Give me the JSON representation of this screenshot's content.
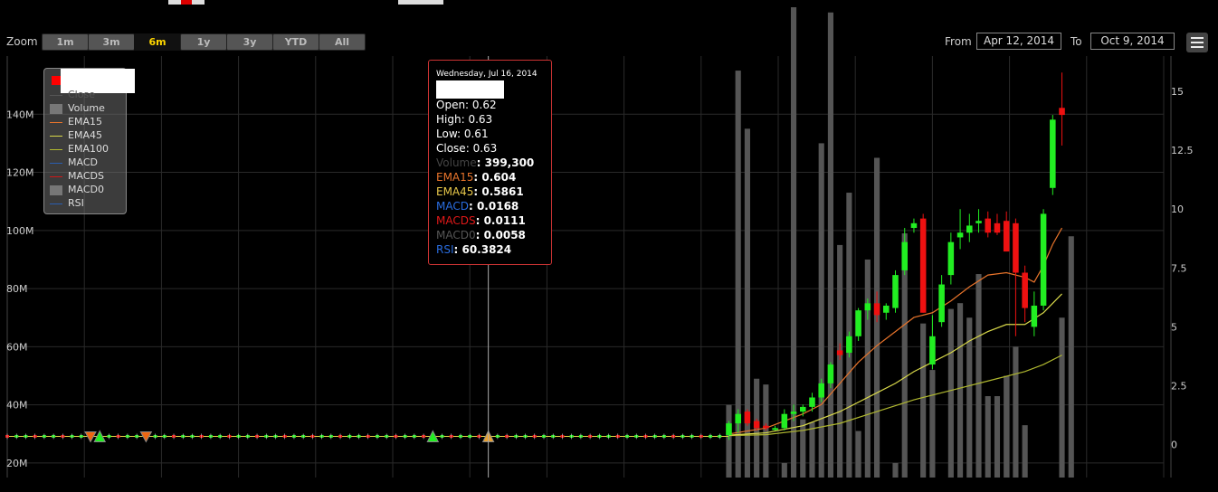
{
  "toolbar": {
    "zoom_label": "Zoom",
    "ranges": [
      "1m",
      "3m",
      "6m",
      "1y",
      "3y",
      "YTD",
      "All"
    ],
    "active_range": "6m",
    "from_label": "From",
    "from_date": "Apr 12, 2014",
    "to_label": "To",
    "to_date": "Oct 9, 2014",
    "menu_icon": "hamburger-icon"
  },
  "legend": {
    "items": [
      {
        "label": "Close",
        "color": "#555555",
        "type": "line"
      },
      {
        "label": "Volume",
        "color": "#777777",
        "type": "box"
      },
      {
        "label": "EMA15",
        "color": "#e8742b",
        "type": "line"
      },
      {
        "label": "EMA45",
        "color": "#d9d94a",
        "type": "line"
      },
      {
        "label": "EMA100",
        "color": "#b0b830",
        "type": "line"
      },
      {
        "label": "MACD",
        "color": "#2a5db0",
        "type": "line"
      },
      {
        "label": "MACDS",
        "color": "#d01818",
        "type": "line"
      },
      {
        "label": "MACD0",
        "color": "#777777",
        "type": "box"
      },
      {
        "label": "RSI",
        "color": "#2a5db0",
        "type": "line"
      }
    ]
  },
  "tooltip": {
    "date": "Wednesday, Jul 16, 2014",
    "open_label": "Open:",
    "open": "0.62",
    "high_label": "High:",
    "high": "0.63",
    "low_label": "Low:",
    "low": "0.61",
    "close_label": "Close:",
    "close": "0.63",
    "volume_label": "Volume",
    "volume": ": 399,300",
    "ema15_label": "EMA15",
    "ema15": ": 0.604",
    "ema45_label": "EMA45",
    "ema45": ": 0.5861",
    "macd_label": "MACD",
    "macd": ": 0.0168",
    "macds_label": "MACDS",
    "macds": ": 0.0111",
    "macd0_label": "MACD0",
    "macd0": ": 0.0058",
    "rsi_label": "RSI",
    "rsi": ": 60.3824"
  },
  "colors": {
    "up": "#22ee22",
    "down": "#ee1111",
    "volume": "#555555",
    "ema15": "#e8742b",
    "ema45": "#d9d94a",
    "ema100": "#b0b830",
    "grid": "#2a2a2a",
    "background": "#000000"
  },
  "chart_data": {
    "type": "candlestick",
    "left_axis": {
      "ticks": [
        "20M",
        "40M",
        "60M",
        "80M",
        "100M",
        "120M",
        "140M"
      ],
      "values": [
        20,
        40,
        60,
        80,
        100,
        120,
        140
      ]
    },
    "right_axis": {
      "ticks": [
        "0",
        "2.5",
        "5",
        "7.5",
        "10",
        "12.5",
        "15"
      ],
      "values": [
        0,
        2.5,
        5,
        7.5,
        10,
        12.5,
        15
      ]
    },
    "ylim_right": [
      -1.4,
      16.5
    ],
    "ylim_left": [
      15,
      160
    ],
    "x_range": [
      0,
      125
    ],
    "crosshair_x": 52,
    "grid": true,
    "flat_period": {
      "x_start": 0,
      "x_end": 78,
      "price": 0.35
    },
    "markers": [
      {
        "x": 9,
        "type": "down",
        "color": "#ee6611"
      },
      {
        "x": 10,
        "type": "up",
        "color": "#22ee22"
      },
      {
        "x": 15,
        "type": "down",
        "color": "#ee6611"
      },
      {
        "x": 46,
        "type": "up",
        "color": "#22ee22"
      },
      {
        "x": 52,
        "type": "up",
        "color": "#e8a030"
      }
    ],
    "candles": [
      {
        "x": 78,
        "o": 0.4,
        "h": 1.0,
        "l": 0.2,
        "c": 0.9
      },
      {
        "x": 79,
        "o": 0.9,
        "h": 1.5,
        "l": 0.5,
        "c": 1.3
      },
      {
        "x": 80,
        "o": 1.4,
        "h": 1.5,
        "l": 0.8,
        "c": 0.9
      },
      {
        "x": 81,
        "o": 1.0,
        "h": 1.1,
        "l": 0.6,
        "c": 0.7
      },
      {
        "x": 82,
        "o": 0.8,
        "h": 0.9,
        "l": 0.6,
        "c": 0.7
      },
      {
        "x": 83,
        "o": 0.7,
        "h": 0.8,
        "l": 0.6,
        "c": 0.7
      },
      {
        "x": 84,
        "o": 0.7,
        "h": 1.5,
        "l": 0.6,
        "c": 1.3
      },
      {
        "x": 85,
        "o": 1.3,
        "h": 1.7,
        "l": 1.0,
        "c": 1.4
      },
      {
        "x": 86,
        "o": 1.4,
        "h": 1.7,
        "l": 1.2,
        "c": 1.6
      },
      {
        "x": 87,
        "o": 1.6,
        "h": 2.2,
        "l": 1.4,
        "c": 2.0
      },
      {
        "x": 88,
        "o": 2.0,
        "h": 2.8,
        "l": 1.8,
        "c": 2.6
      },
      {
        "x": 89,
        "o": 2.6,
        "h": 3.5,
        "l": 2.4,
        "c": 3.4
      },
      {
        "x": 90,
        "o": 4.0,
        "h": 4.3,
        "l": 3.6,
        "c": 3.8
      },
      {
        "x": 91,
        "o": 3.9,
        "h": 4.8,
        "l": 3.7,
        "c": 4.6
      },
      {
        "x": 92,
        "o": 4.6,
        "h": 5.8,
        "l": 4.4,
        "c": 5.7
      },
      {
        "x": 93,
        "o": 5.7,
        "h": 6.2,
        "l": 5.3,
        "c": 6.0
      },
      {
        "x": 94,
        "o": 6.0,
        "h": 6.5,
        "l": 5.2,
        "c": 5.5
      },
      {
        "x": 95,
        "o": 5.6,
        "h": 6.0,
        "l": 5.3,
        "c": 5.9
      },
      {
        "x": 96,
        "o": 5.8,
        "h": 7.4,
        "l": 5.6,
        "c": 7.2
      },
      {
        "x": 97,
        "o": 7.4,
        "h": 9.2,
        "l": 7.2,
        "c": 8.6
      },
      {
        "x": 98,
        "o": 9.2,
        "h": 9.6,
        "l": 9.0,
        "c": 9.4
      },
      {
        "x": 99,
        "o": 9.6,
        "h": 9.8,
        "l": 5.6,
        "c": 5.6
      },
      {
        "x": 100,
        "o": 3.4,
        "h": 5.5,
        "l": 3.2,
        "c": 4.6
      },
      {
        "x": 101,
        "o": 5.2,
        "h": 7.2,
        "l": 5.0,
        "c": 6.8
      },
      {
        "x": 102,
        "o": 7.2,
        "h": 9.0,
        "l": 6.8,
        "c": 8.6
      },
      {
        "x": 103,
        "o": 8.8,
        "h": 10.0,
        "l": 8.3,
        "c": 9.0
      },
      {
        "x": 104,
        "o": 9.0,
        "h": 9.8,
        "l": 8.6,
        "c": 9.3
      },
      {
        "x": 105,
        "o": 9.4,
        "h": 10.0,
        "l": 9.0,
        "c": 9.5
      },
      {
        "x": 106,
        "o": 9.6,
        "h": 9.9,
        "l": 8.8,
        "c": 9.0
      },
      {
        "x": 107,
        "o": 9.4,
        "h": 9.8,
        "l": 8.9,
        "c": 9.0
      },
      {
        "x": 108,
        "o": 9.5,
        "h": 9.9,
        "l": 8.2,
        "c": 8.2
      },
      {
        "x": 109,
        "o": 9.4,
        "h": 9.6,
        "l": 4.6,
        "c": 7.3
      },
      {
        "x": 110,
        "o": 7.3,
        "h": 7.6,
        "l": 5.2,
        "c": 5.8
      },
      {
        "x": 111,
        "o": 5.0,
        "h": 6.5,
        "l": 4.6,
        "c": 5.9
      },
      {
        "x": 112,
        "o": 5.9,
        "h": 10.0,
        "l": 5.7,
        "c": 9.8
      },
      {
        "x": 113,
        "o": 10.9,
        "h": 14.0,
        "l": 10.6,
        "c": 13.8
      },
      {
        "x": 114,
        "o": 14.3,
        "h": 15.8,
        "l": 12.7,
        "c": 14.0
      }
    ],
    "volume": [
      {
        "x": 78,
        "v": 40
      },
      {
        "x": 79,
        "v": 155
      },
      {
        "x": 80,
        "v": 135
      },
      {
        "x": 81,
        "v": 49
      },
      {
        "x": 82,
        "v": 47
      },
      {
        "x": 84,
        "v": 20
      },
      {
        "x": 85,
        "v": 178
      },
      {
        "x": 86,
        "v": 35
      },
      {
        "x": 87,
        "v": 34
      },
      {
        "x": 88,
        "v": 130
      },
      {
        "x": 89,
        "v": 175
      },
      {
        "x": 90,
        "v": 95
      },
      {
        "x": 91,
        "v": 113
      },
      {
        "x": 92,
        "v": 31
      },
      {
        "x": 93,
        "v": 90
      },
      {
        "x": 94,
        "v": 125
      },
      {
        "x": 95,
        "v": 12
      },
      {
        "x": 96,
        "v": 20
      },
      {
        "x": 97,
        "v": 99
      },
      {
        "x": 98,
        "v": 8
      },
      {
        "x": 99,
        "v": 68
      },
      {
        "x": 100,
        "v": 52
      },
      {
        "x": 101,
        "v": 15
      },
      {
        "x": 102,
        "v": 73
      },
      {
        "x": 103,
        "v": 75
      },
      {
        "x": 104,
        "v": 70
      },
      {
        "x": 105,
        "v": 85
      },
      {
        "x": 106,
        "v": 43
      },
      {
        "x": 107,
        "v": 43
      },
      {
        "x": 108,
        "v": 50
      },
      {
        "x": 109,
        "v": 60
      },
      {
        "x": 110,
        "v": 33
      },
      {
        "x": 111,
        "v": 10
      },
      {
        "x": 112,
        "v": 15
      },
      {
        "x": 113,
        "v": 10
      },
      {
        "x": 114,
        "v": 70
      },
      {
        "x": 115,
        "v": 98
      }
    ],
    "ema15": [
      [
        78,
        0.45
      ],
      [
        82,
        0.7
      ],
      [
        86,
        1.3
      ],
      [
        88,
        1.7
      ],
      [
        90,
        2.6
      ],
      [
        92,
        3.5
      ],
      [
        94,
        4.2
      ],
      [
        96,
        4.8
      ],
      [
        98,
        5.4
      ],
      [
        99,
        5.5
      ],
      [
        100,
        5.6
      ],
      [
        102,
        6.1
      ],
      [
        104,
        6.7
      ],
      [
        106,
        7.2
      ],
      [
        108,
        7.3
      ],
      [
        110,
        7.1
      ],
      [
        111,
        6.9
      ],
      [
        112,
        7.6
      ],
      [
        113,
        8.5
      ],
      [
        114,
        9.2
      ]
    ],
    "ema45": [
      [
        78,
        0.4
      ],
      [
        82,
        0.5
      ],
      [
        86,
        0.8
      ],
      [
        90,
        1.4
      ],
      [
        94,
        2.2
      ],
      [
        96,
        2.6
      ],
      [
        98,
        3.1
      ],
      [
        100,
        3.5
      ],
      [
        102,
        3.9
      ],
      [
        104,
        4.4
      ],
      [
        106,
        4.8
      ],
      [
        108,
        5.1
      ],
      [
        110,
        5.1
      ],
      [
        112,
        5.6
      ],
      [
        114,
        6.4
      ]
    ],
    "ema100": [
      [
        78,
        0.38
      ],
      [
        82,
        0.42
      ],
      [
        86,
        0.6
      ],
      [
        90,
        0.9
      ],
      [
        94,
        1.4
      ],
      [
        98,
        1.9
      ],
      [
        102,
        2.3
      ],
      [
        106,
        2.7
      ],
      [
        110,
        3.1
      ],
      [
        112,
        3.4
      ],
      [
        114,
        3.8
      ]
    ]
  }
}
